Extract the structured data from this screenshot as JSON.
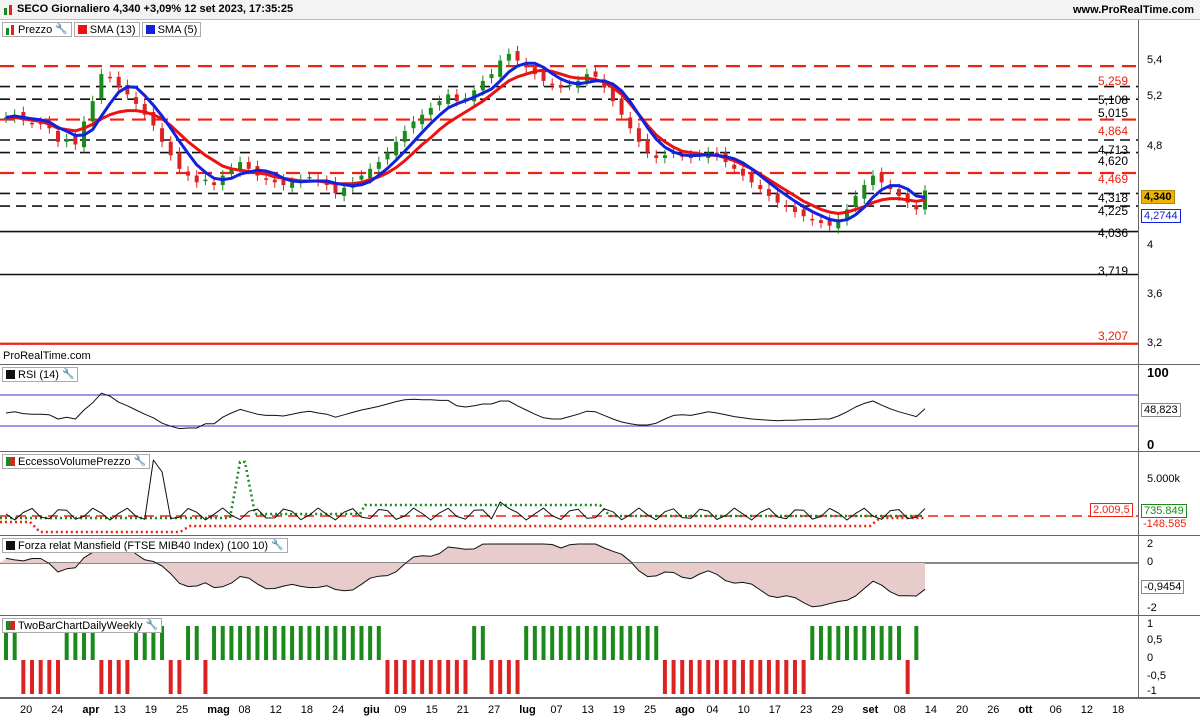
{
  "header": {
    "title": "SECO Giornaliero 4,340 +3,09% 12 set 2023, 17:35:25",
    "brand": "www.ProRealTime.com"
  },
  "price_panel": {
    "legend": [
      {
        "label": "Prezzo",
        "icon": "candle-icon"
      },
      {
        "label": "SMA (13)",
        "color": "#ee1111"
      },
      {
        "label": "SMA (5)",
        "color": "#1122dd"
      }
    ],
    "watermark": "ProRealTime.com",
    "levels": [
      "5,259",
      "5,108",
      "5,015",
      "4,864",
      "4,713",
      "4,620",
      "4,469",
      "4,318",
      "4,225",
      "4,036",
      "3,719",
      "3,207"
    ],
    "axis_ticks": [
      "5,4",
      "5,2",
      "4,8",
      "4",
      "3,6",
      "3,2"
    ],
    "last_price": "4,340",
    "sma_value": "4,2744"
  },
  "rsi_panel": {
    "legend": "RSI (14)",
    "axis_ticks": [
      "100",
      "0"
    ],
    "value": "48,823"
  },
  "volume_panel": {
    "legend": "EccessoVolumePrezzo",
    "axis_ticks": [
      "5.000k"
    ],
    "tag_red": "2.009,5",
    "tag_green": "735.849",
    "tag_black": "-148.585"
  },
  "mansfield_panel": {
    "legend": "Forza relat Mansfield (FTSE MIB40 Index) (100 10)",
    "axis_ticks": [
      "2",
      "0",
      "-2"
    ],
    "value": "-0,9454"
  },
  "twobar_panel": {
    "legend": "TwoBarChartDailyWeekly",
    "axis_ticks": [
      "1",
      "0,5",
      "0",
      "-0,5",
      "-1"
    ]
  },
  "x_axis": [
    "20",
    "24",
    "apr",
    "13",
    "19",
    "25",
    "mag",
    "08",
    "12",
    "18",
    "24",
    "giu",
    "09",
    "15",
    "21",
    "27",
    "lug",
    "07",
    "13",
    "19",
    "25",
    "ago",
    "04",
    "10",
    "17",
    "23",
    "29",
    "set",
    "08",
    "14",
    "20",
    "26",
    "ott",
    "06",
    "12",
    "18"
  ],
  "chart_data": {
    "type": "candlestick",
    "price_range": [
      3.05,
      5.6
    ],
    "horizontal_levels": [
      5.259,
      5.108,
      5.015,
      4.864,
      4.713,
      4.62,
      4.469,
      4.318,
      4.225,
      4.036,
      3.719,
      3.207
    ],
    "close_series": [
      4.88,
      4.9,
      4.86,
      4.84,
      4.83,
      4.8,
      4.7,
      4.72,
      4.68,
      4.85,
      5.0,
      5.2,
      5.18,
      5.1,
      5.05,
      4.98,
      4.9,
      4.82,
      4.7,
      4.6,
      4.5,
      4.45,
      4.4,
      4.42,
      4.38,
      4.45,
      4.5,
      4.55,
      4.5,
      4.45,
      4.42,
      4.4,
      4.38,
      4.4,
      4.42,
      4.44,
      4.41,
      4.38,
      4.32,
      4.36,
      4.4,
      4.45,
      4.5,
      4.55,
      4.62,
      4.7,
      4.78,
      4.85,
      4.9,
      4.95,
      5.0,
      5.05,
      5.0,
      5.02,
      5.08,
      5.15,
      5.2,
      5.3,
      5.35,
      5.3,
      5.25,
      5.2,
      5.15,
      5.12,
      5.1,
      5.12,
      5.15,
      5.2,
      5.18,
      5.1,
      5.0,
      4.9,
      4.8,
      4.7,
      4.62,
      4.58,
      4.6,
      4.62,
      4.6,
      4.58,
      4.6,
      4.62,
      4.6,
      4.55,
      4.5,
      4.45,
      4.4,
      4.35,
      4.3,
      4.25,
      4.22,
      4.18,
      4.15,
      4.12,
      4.1,
      4.08,
      4.12,
      4.2,
      4.3,
      4.38,
      4.45,
      4.4,
      4.35,
      4.3,
      4.25,
      4.2,
      4.34
    ],
    "sma13_series": [
      4.88,
      4.88,
      4.87,
      4.86,
      4.85,
      4.83,
      4.8,
      4.79,
      4.78,
      4.8,
      4.83,
      4.87,
      4.9,
      4.92,
      4.93,
      4.93,
      4.92,
      4.9,
      4.87,
      4.82,
      4.76,
      4.7,
      4.65,
      4.6,
      4.56,
      4.52,
      4.5,
      4.49,
      4.48,
      4.47,
      4.46,
      4.44,
      4.43,
      4.42,
      4.41,
      4.41,
      4.41,
      4.4,
      4.39,
      4.39,
      4.39,
      4.4,
      4.42,
      4.44,
      4.47,
      4.51,
      4.56,
      4.62,
      4.68,
      4.73,
      4.79,
      4.84,
      4.88,
      4.92,
      4.96,
      5.0,
      5.05,
      5.1,
      5.15,
      5.18,
      5.2,
      5.22,
      5.23,
      5.22,
      5.2,
      5.18,
      5.17,
      5.17,
      5.16,
      5.14,
      5.1,
      5.05,
      4.98,
      4.9,
      4.82,
      4.75,
      4.7,
      4.66,
      4.63,
      4.62,
      4.61,
      4.6,
      4.6,
      4.58,
      4.56,
      4.53,
      4.5,
      4.46,
      4.42,
      4.38,
      4.34,
      4.3,
      4.26,
      4.23,
      4.2,
      4.18,
      4.17,
      4.18,
      4.2,
      4.22,
      4.25,
      4.27,
      4.28,
      4.28,
      4.27,
      4.26,
      4.27
    ]
  }
}
